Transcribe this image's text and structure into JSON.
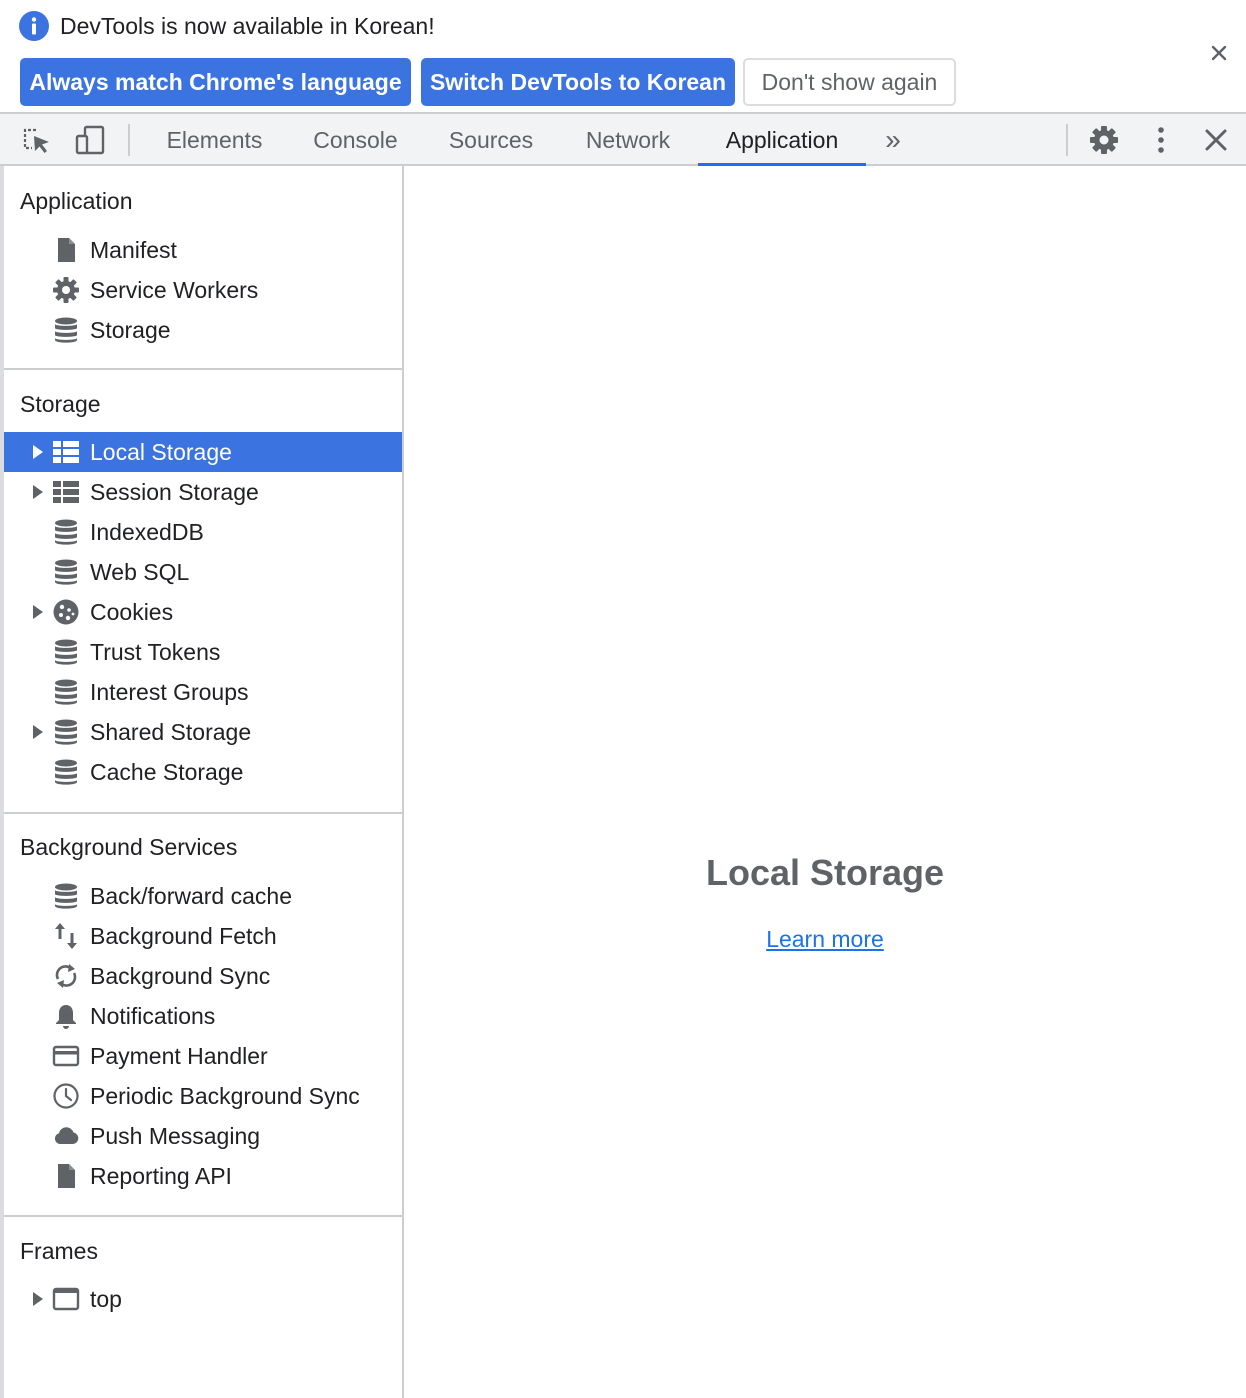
{
  "infobar": {
    "message": "DevTools is now available in Korean!",
    "buttons": {
      "match_language": "Always match Chrome's language",
      "switch_korean": "Switch DevTools to Korean",
      "dont_show": "Don't show again"
    }
  },
  "toolbar": {
    "tabs": [
      "Elements",
      "Console",
      "Sources",
      "Network",
      "Application"
    ],
    "active_tab": "Application",
    "more_tabs_glyph": "»"
  },
  "sidebar": {
    "sections": [
      {
        "title": "Application",
        "items": [
          {
            "label": "Manifest",
            "icon": "document-icon"
          },
          {
            "label": "Service Workers",
            "icon": "gear-icon"
          },
          {
            "label": "Storage",
            "icon": "database-icon"
          }
        ]
      },
      {
        "title": "Storage",
        "items": [
          {
            "label": "Local Storage",
            "icon": "table-icon",
            "expandable": true,
            "selected": true
          },
          {
            "label": "Session Storage",
            "icon": "table-icon",
            "expandable": true
          },
          {
            "label": "IndexedDB",
            "icon": "database-icon"
          },
          {
            "label": "Web SQL",
            "icon": "database-icon"
          },
          {
            "label": "Cookies",
            "icon": "cookie-icon",
            "expandable": true
          },
          {
            "label": "Trust Tokens",
            "icon": "database-icon"
          },
          {
            "label": "Interest Groups",
            "icon": "database-icon"
          },
          {
            "label": "Shared Storage",
            "icon": "database-icon",
            "expandable": true
          },
          {
            "label": "Cache Storage",
            "icon": "database-icon"
          }
        ]
      },
      {
        "title": "Background Services",
        "items": [
          {
            "label": "Back/forward cache",
            "icon": "database-icon"
          },
          {
            "label": "Background Fetch",
            "icon": "up-down-arrows-icon"
          },
          {
            "label": "Background Sync",
            "icon": "sync-icon"
          },
          {
            "label": "Notifications",
            "icon": "bell-icon"
          },
          {
            "label": "Payment Handler",
            "icon": "credit-card-icon"
          },
          {
            "label": "Periodic Background Sync",
            "icon": "clock-icon"
          },
          {
            "label": "Push Messaging",
            "icon": "cloud-icon"
          },
          {
            "label": "Reporting API",
            "icon": "document-icon"
          }
        ]
      },
      {
        "title": "Frames",
        "items": [
          {
            "label": "top",
            "icon": "frame-icon",
            "expandable": true
          }
        ]
      }
    ]
  },
  "main": {
    "title": "Local Storage",
    "link": "Learn more"
  },
  "colors": {
    "accent": "#3b73e1",
    "link": "#1a73e8",
    "icon_gray": "#5f6368",
    "border": "#cbcdd1",
    "toolbar_bg": "#f1f3f4"
  }
}
